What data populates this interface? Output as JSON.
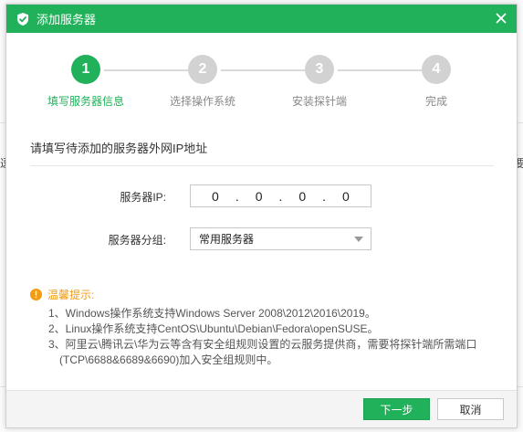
{
  "dialog": {
    "title": "添加服务器"
  },
  "steps": [
    {
      "num": "1",
      "label": "填写服务器信息",
      "active": true
    },
    {
      "num": "2",
      "label": "选择操作系统",
      "active": false
    },
    {
      "num": "3",
      "label": "安装探针端",
      "active": false
    },
    {
      "num": "4",
      "label": "完成",
      "active": false
    }
  ],
  "section": {
    "heading": "请填写待添加的服务器外网IP地址"
  },
  "form": {
    "ip_label": "服务器IP:",
    "ip": [
      "0",
      "0",
      "0",
      "0"
    ],
    "group_label": "服务器分组:",
    "group_value": "常用服务器"
  },
  "tips": {
    "title": "温馨提示:",
    "items": [
      "1、Windows操作系统支持Windows Server 2008\\2012\\2016\\2019。",
      "2、Linux操作系统支持CentOS\\Ubuntu\\Debian\\Fedora\\openSUSE。",
      "3、阿里云\\腾讯云\\华为云等含有安全组规则设置的云服务提供商，需要将探针端所需端口",
      "(TCP\\6688&6689&6690)加入安全组规则中。"
    ]
  },
  "footer": {
    "next_label": "下一步",
    "cancel_label": "取消"
  },
  "background": {
    "left_fragment": "逗",
    "right_fragment": "要"
  },
  "colors": {
    "brand": "#20b15a",
    "warning": "#f39c12",
    "inactive_step": "#d2d2d2"
  }
}
